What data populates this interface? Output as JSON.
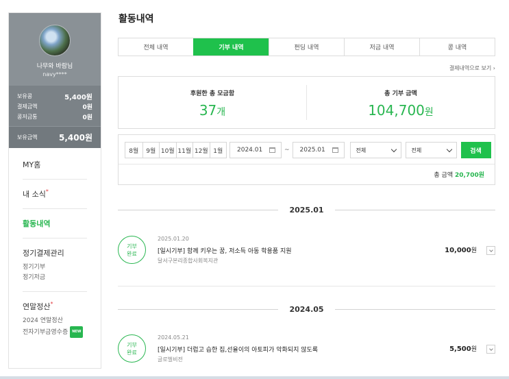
{
  "sidebar": {
    "nickname": "나무와 바람님",
    "user_id": "navy****",
    "points": [
      {
        "label": "보유콩",
        "value": "5,400원"
      },
      {
        "label": "결제금액",
        "value": "0원"
      },
      {
        "label": "콩저금통",
        "value": "0원"
      }
    ],
    "balance": {
      "label": "보유금액",
      "value": "5,400원"
    },
    "menu": {
      "my_home": "MY홈",
      "my_news": "내 소식",
      "activity": "활동내역",
      "recurring": "정기결제관리",
      "recurring_sub": [
        "정기기부",
        "정기저금"
      ],
      "year_end": "연말정산",
      "year_end_sub": [
        "2024 연말정산",
        "전자기부금영수증"
      ],
      "new_badge": "NEW"
    }
  },
  "main": {
    "title": "활동내역",
    "tabs": [
      "전체 내역",
      "기부 내역",
      "펀딩 내역",
      "저금 내역",
      "콩 내역"
    ],
    "payment_link": "결제내역으로 보기",
    "summary": {
      "raised_label": "후원한 총 모금함",
      "raised_value": "37",
      "raised_unit": "개",
      "amount_label": "총 기부 금액",
      "amount_value": "104,700",
      "amount_unit": "원"
    },
    "filter": {
      "months": [
        "8월",
        "9월",
        "10월",
        "11월",
        "12월",
        "1월"
      ],
      "start_date": "2024.01",
      "separator": "~",
      "end_date": "2025.01",
      "select1": "전체",
      "select2": "전체",
      "search": "검색",
      "total_label": "총 금액",
      "total_value": "20,700원"
    },
    "groups": [
      {
        "month": "2025.01",
        "records": [
          {
            "badge": [
              "기부",
              "완료"
            ],
            "date": "2025.01.20",
            "title": "[일시기부] 함께 키우는 꿈, 저소득 아동 학용품 지원",
            "org": "달서구본리종합사회복지관",
            "amount": "10,000",
            "unit": "원"
          }
        ]
      },
      {
        "month": "2024.05",
        "records": [
          {
            "badge": [
              "기부",
              "완료"
            ],
            "date": "2024.05.21",
            "title": "[일시기부] 더럽고 습한 집,선율이의 아토피가 악화되지 않도록",
            "org": "글로벌비전",
            "amount": "5,500",
            "unit": "원"
          }
        ]
      }
    ]
  }
}
